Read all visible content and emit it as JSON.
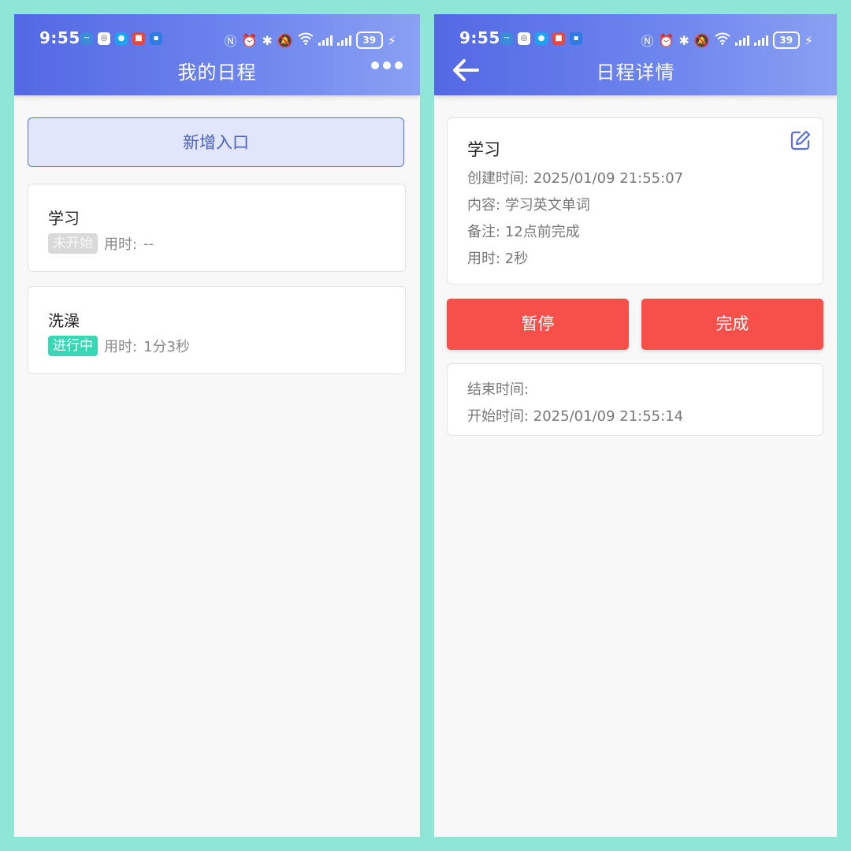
{
  "status_bar": {
    "time": "9:55",
    "battery": "39"
  },
  "list_screen": {
    "title": "我的日程",
    "add_button": "新增入口",
    "tasks": [
      {
        "title": "学习",
        "status": "未开始",
        "duration_label": "用时:",
        "duration": "--"
      },
      {
        "title": "洗澡",
        "status": "进行中",
        "duration_label": "用时:",
        "duration": "1分3秒"
      }
    ]
  },
  "detail_screen": {
    "title": "日程详情",
    "task_title": "学习",
    "created": "创建时间:  2025/01/09 21:55:07",
    "content": "内容:  学习英文单词",
    "note": "备注:  12点前完成",
    "elapsed": "用时:  2秒",
    "pause_button": "暂停",
    "done_button": "完成",
    "end_time": "结束时间:",
    "start_time": "开始时间:  2025/01/09 21:55:14"
  },
  "colors": {
    "background": "#8fe6d6",
    "header_start": "#5368e4",
    "header_end": "#8aa0f3",
    "accent": "#5a6fd8",
    "danger": "#f7504b",
    "status_not_started": "#d9d9d9",
    "status_in_progress": "#38d8b6"
  },
  "icons": [
    "more-horizontal-icon",
    "back-arrow-icon",
    "edit-icon",
    "wifi-icon",
    "bluetooth-icon",
    "alarm-icon",
    "mute-icon",
    "nfc-icon",
    "battery-icon"
  ]
}
